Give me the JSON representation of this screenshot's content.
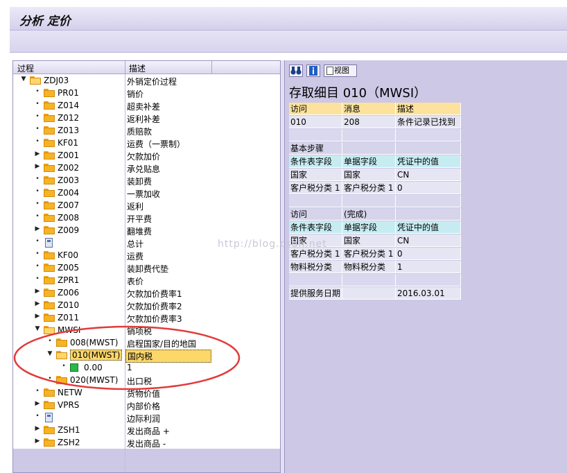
{
  "title": "分析 定价",
  "tree_header": {
    "col1": "过程",
    "col2": "描述"
  },
  "tree_rows": [
    {
      "label": "ZDJ03",
      "desc": "外销定价过程",
      "level": 0,
      "toggle": "▼",
      "icon": "folder-open"
    },
    {
      "label": "PR01",
      "desc": "销价",
      "level": 1,
      "toggle": "•",
      "icon": "folder"
    },
    {
      "label": "Z014",
      "desc": "超卖补差",
      "level": 1,
      "toggle": "•",
      "icon": "folder"
    },
    {
      "label": "Z012",
      "desc": "返利补差",
      "level": 1,
      "toggle": "•",
      "icon": "folder"
    },
    {
      "label": "Z013",
      "desc": "质赔款",
      "level": 1,
      "toggle": "•",
      "icon": "folder"
    },
    {
      "label": "KF01",
      "desc": "运费（一票制）",
      "level": 1,
      "toggle": "•",
      "icon": "folder"
    },
    {
      "label": "Z001",
      "desc": "欠款加价",
      "level": 1,
      "toggle": "▶",
      "icon": "folder"
    },
    {
      "label": "Z002",
      "desc": "承兑贴息",
      "level": 1,
      "toggle": "▶",
      "icon": "folder"
    },
    {
      "label": "Z003",
      "desc": "装卸费",
      "level": 1,
      "toggle": "•",
      "icon": "folder"
    },
    {
      "label": "Z004",
      "desc": "一票加收",
      "level": 1,
      "toggle": "•",
      "icon": "folder"
    },
    {
      "label": "Z007",
      "desc": "返利",
      "level": 1,
      "toggle": "•",
      "icon": "folder"
    },
    {
      "label": "Z008",
      "desc": "开平费",
      "level": 1,
      "toggle": "•",
      "icon": "folder"
    },
    {
      "label": "Z009",
      "desc": "翻堆费",
      "level": 1,
      "toggle": "▶",
      "icon": "folder"
    },
    {
      "label": "",
      "desc": "总计",
      "level": 1,
      "toggle": "•",
      "icon": "calc"
    },
    {
      "label": "KF00",
      "desc": "运费",
      "level": 1,
      "toggle": "•",
      "icon": "folder"
    },
    {
      "label": "Z005",
      "desc": "装卸费代垫",
      "level": 1,
      "toggle": "•",
      "icon": "folder"
    },
    {
      "label": "ZPR1",
      "desc": "表价",
      "level": 1,
      "toggle": "•",
      "icon": "folder"
    },
    {
      "label": "Z006",
      "desc": "欠款加价费率1",
      "level": 1,
      "toggle": "▶",
      "icon": "folder"
    },
    {
      "label": "Z010",
      "desc": "欠款加价费率2",
      "level": 1,
      "toggle": "▶",
      "icon": "folder"
    },
    {
      "label": "Z011",
      "desc": "欠款加价费率3",
      "level": 1,
      "toggle": "▶",
      "icon": "folder"
    },
    {
      "label": "MWSI",
      "desc": "销项税",
      "level": 1,
      "toggle": "▼",
      "icon": "folder-open"
    },
    {
      "label": "008(MWST)",
      "desc": "启程国家/目的地国",
      "level": 2,
      "toggle": "•",
      "icon": "folder"
    },
    {
      "label": "010(MWST)",
      "desc": "国内税",
      "level": 2,
      "toggle": "▼",
      "icon": "folder-open",
      "selected": true
    },
    {
      "label": "0.00",
      "desc": "1",
      "level": 3,
      "toggle": "•",
      "icon": "green"
    },
    {
      "label": "020(MWST)",
      "desc": "出口税",
      "level": 2,
      "toggle": "•",
      "icon": "folder"
    },
    {
      "label": "NETW",
      "desc": "货物价值",
      "level": 1,
      "toggle": "•",
      "icon": "folder"
    },
    {
      "label": "VPRS",
      "desc": "内部价格",
      "level": 1,
      "toggle": "▶",
      "icon": "folder"
    },
    {
      "label": "",
      "desc": "边际利润",
      "level": 1,
      "toggle": "•",
      "icon": "calc"
    },
    {
      "label": "ZSH1",
      "desc": "发出商品 +",
      "level": 1,
      "toggle": "▶",
      "icon": "folder"
    },
    {
      "label": "ZSH2",
      "desc": "发出商品 -",
      "level": 1,
      "toggle": "▶",
      "icon": "folder"
    }
  ],
  "right_toolbar": {
    "view_label": "视图"
  },
  "detail_title": "存取细目 010（MWSI）",
  "detail_rows": [
    {
      "type": "hl",
      "cells": [
        "访问",
        "消息",
        "描述"
      ]
    },
    {
      "type": "data",
      "cells": [
        "010",
        "208",
        "条件记录已找到"
      ]
    },
    {
      "type": "empty",
      "cells": [
        "",
        "",
        ""
      ]
    },
    {
      "type": "sec",
      "cells": [
        "基本步骤",
        "",
        ""
      ]
    },
    {
      "type": "hdr",
      "cells": [
        "条件表字段",
        "单据字段",
        "凭证中的值"
      ]
    },
    {
      "type": "data",
      "cells": [
        "国家",
        "国家",
        "CN"
      ]
    },
    {
      "type": "data",
      "cells": [
        "客户税分类 1",
        "客户税分类 1",
        "0"
      ]
    },
    {
      "type": "empty",
      "cells": [
        "",
        "",
        ""
      ]
    },
    {
      "type": "sec",
      "cells": [
        "访问",
        "(完成)",
        ""
      ]
    },
    {
      "type": "hdr",
      "cells": [
        "条件表字段",
        "单据字段",
        "凭证中的值"
      ]
    },
    {
      "type": "data",
      "cells": [
        "国家",
        "国家",
        "CN"
      ]
    },
    {
      "type": "data",
      "cells": [
        "客户税分类 1",
        "客户税分类 1",
        "0"
      ]
    },
    {
      "type": "data",
      "cells": [
        "物料税分类",
        "物料税分类",
        "1"
      ]
    },
    {
      "type": "empty",
      "cells": [
        "",
        "",
        ""
      ]
    },
    {
      "type": "data",
      "cells": [
        "提供服务日期",
        "",
        "2016.03.01"
      ]
    }
  ],
  "watermark": "http://blog.csdn.net"
}
